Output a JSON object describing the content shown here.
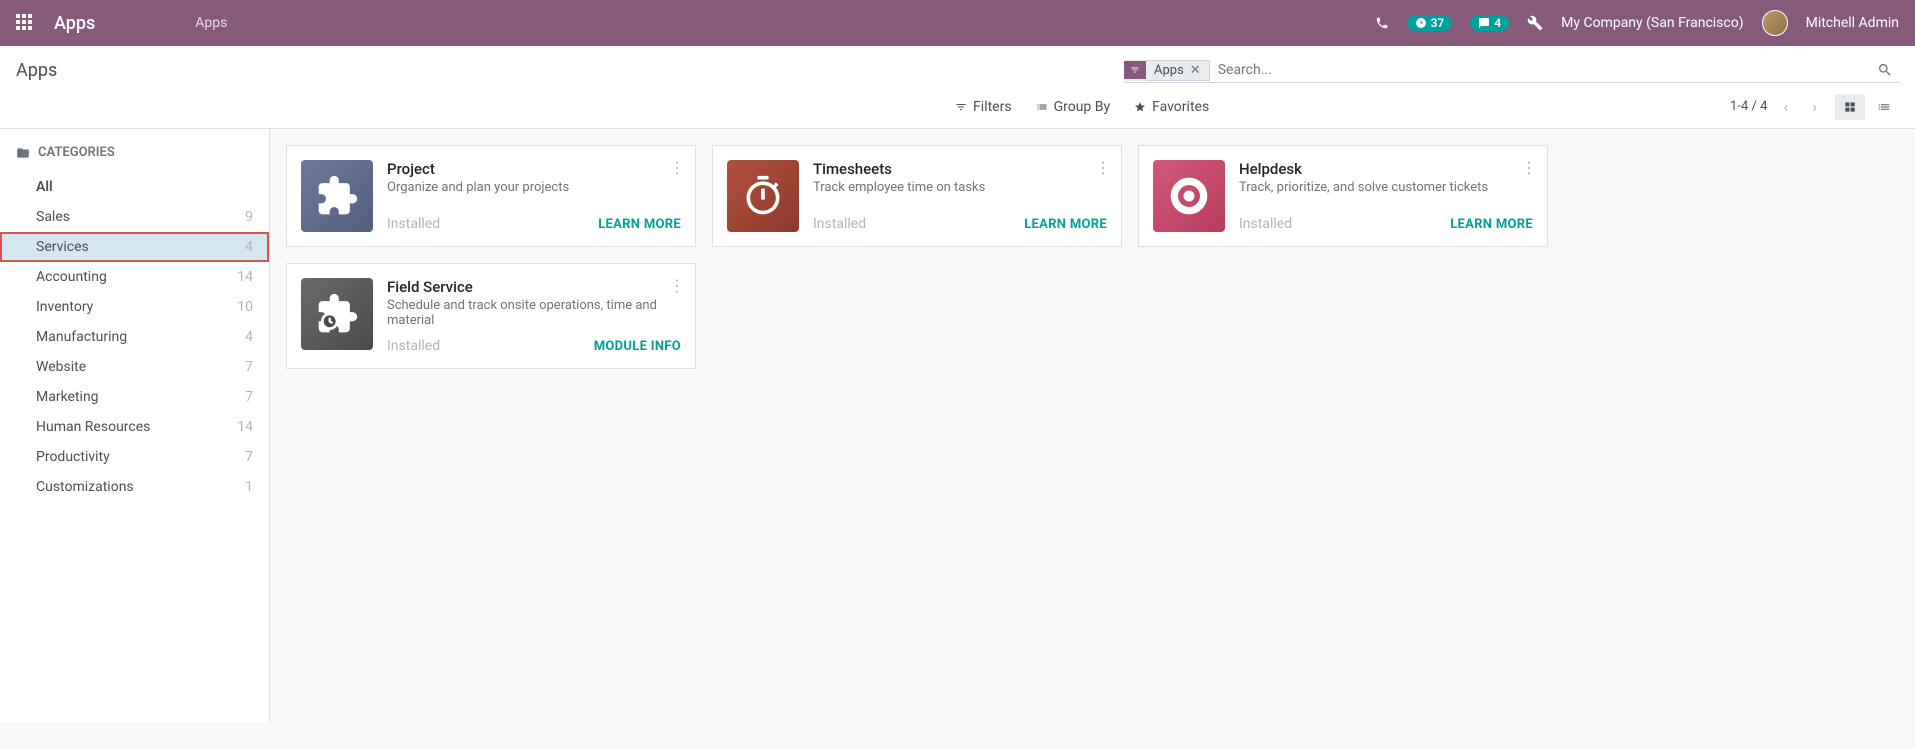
{
  "topbar": {
    "brand": "Apps",
    "breadcrumb": "Apps",
    "badge_activities": "37",
    "badge_messages": "4",
    "company": "My Company (San Francisco)",
    "user": "Mitchell Admin"
  },
  "control": {
    "title": "Apps",
    "search_chip": "Apps",
    "search_placeholder": "Search...",
    "filters_label": "Filters",
    "groupby_label": "Group By",
    "favorites_label": "Favorites",
    "pager": "1-4 / 4"
  },
  "sidebar": {
    "header": "CATEGORIES",
    "all_label": "All",
    "items": [
      {
        "label": "Sales",
        "count": "9"
      },
      {
        "label": "Services",
        "count": "4"
      },
      {
        "label": "Accounting",
        "count": "14"
      },
      {
        "label": "Inventory",
        "count": "10"
      },
      {
        "label": "Manufacturing",
        "count": "4"
      },
      {
        "label": "Website",
        "count": "7"
      },
      {
        "label": "Marketing",
        "count": "7"
      },
      {
        "label": "Human Resources",
        "count": "14"
      },
      {
        "label": "Productivity",
        "count": "7"
      },
      {
        "label": "Customizations",
        "count": "1"
      }
    ]
  },
  "cards": [
    {
      "title": "Project",
      "desc": "Organize and plan your projects",
      "status": "Installed",
      "link": "LEARN MORE",
      "icon": "project"
    },
    {
      "title": "Timesheets",
      "desc": "Track employee time on tasks",
      "status": "Installed",
      "link": "LEARN MORE",
      "icon": "timesheets"
    },
    {
      "title": "Helpdesk",
      "desc": "Track, prioritize, and solve customer tickets",
      "status": "Installed",
      "link": "LEARN MORE",
      "icon": "helpdesk"
    },
    {
      "title": "Field Service",
      "desc": "Schedule and track onsite operations, time and material",
      "status": "Installed",
      "link": "MODULE INFO",
      "icon": "fieldservice"
    }
  ]
}
